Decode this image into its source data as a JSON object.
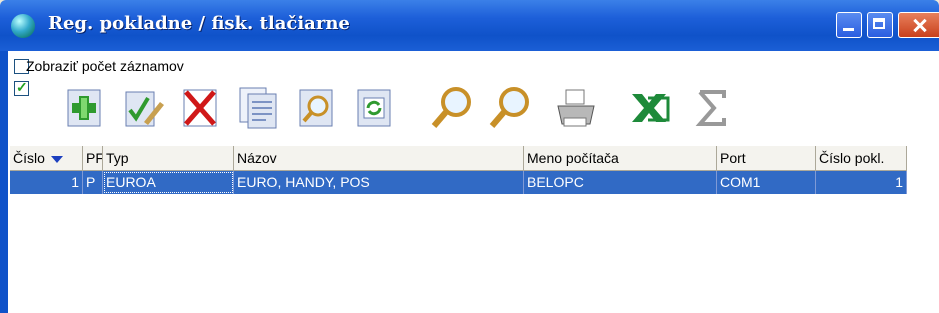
{
  "window": {
    "title": "Reg. pokladne / fisk. tlačiarne"
  },
  "options": {
    "show_count_label": "Zobraziť počet záznamov",
    "show_count_checked": false,
    "second_checked": true
  },
  "toolbar": {
    "items": [
      {
        "name": "add-icon"
      },
      {
        "name": "edit-icon"
      },
      {
        "name": "delete-icon"
      },
      {
        "name": "copy-icon"
      },
      {
        "name": "preview-icon"
      },
      {
        "name": "refresh-icon"
      },
      {
        "name": "search-icon"
      },
      {
        "name": "search-next-icon"
      },
      {
        "name": "print-icon"
      },
      {
        "name": "excel-icon"
      },
      {
        "name": "sum-icon"
      }
    ]
  },
  "grid": {
    "columns": [
      "Číslo",
      "PF",
      "Typ",
      "Názov",
      "Meno počítača",
      "Port",
      "Číslo pokl."
    ],
    "rows": [
      [
        "1",
        "P",
        "EUROA",
        "EURO, HANDY, POS",
        "BELOPC",
        "COM1",
        "1"
      ]
    ]
  },
  "colors": {
    "title_bar": "#0f52c9",
    "selection": "#316ac5"
  }
}
